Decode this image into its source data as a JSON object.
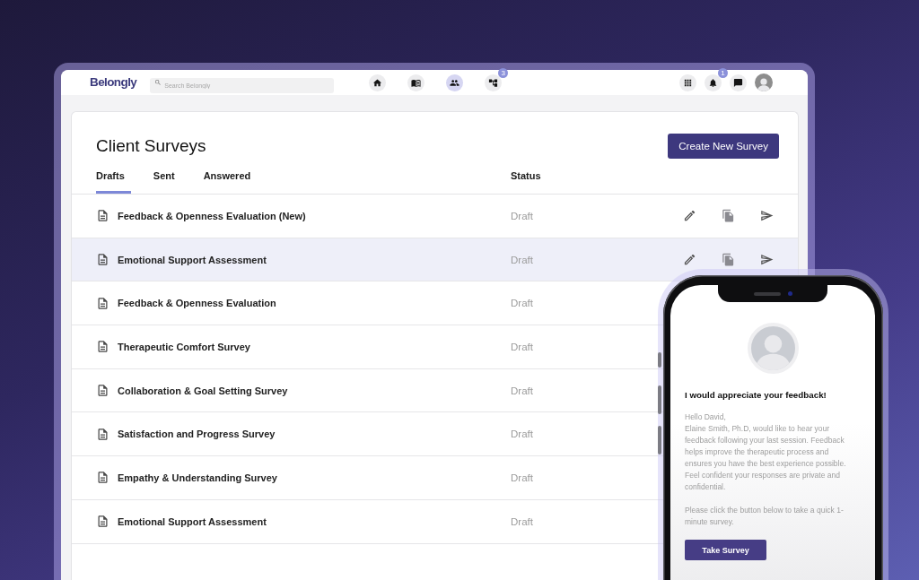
{
  "topbar": {
    "logo": "Belongly",
    "search": {
      "placeholder": "Search Belongly"
    },
    "nav": [
      {
        "kind": "home",
        "selected": false
      },
      {
        "kind": "library",
        "selected": false
      },
      {
        "kind": "people",
        "selected": true
      },
      {
        "kind": "network",
        "selected": false,
        "badge": "3"
      }
    ],
    "actions": [
      {
        "kind": "apps"
      },
      {
        "kind": "notifications",
        "badge": "1"
      },
      {
        "kind": "messages"
      },
      {
        "kind": "avatar"
      }
    ]
  },
  "page": {
    "title": "Client Surveys",
    "create_button": "Create New Survey",
    "tabs": [
      {
        "label": "Drafts",
        "selected": true
      },
      {
        "label": "Sent",
        "selected": false
      },
      {
        "label": "Answered",
        "selected": false
      }
    ]
  },
  "table": {
    "columns": [
      {
        "label": "Status"
      }
    ],
    "rows": [
      {
        "title": "Feedback & Openness Evaluation (New)",
        "status": "Draft",
        "selected": false,
        "actions_visible": true
      },
      {
        "title": "Emotional Support Assessment",
        "status": "Draft",
        "selected": true,
        "actions_visible": true
      },
      {
        "title": "Feedback & Openness Evaluation",
        "status": "Draft",
        "selected": false,
        "actions_visible": false
      },
      {
        "title": "Therapeutic Comfort Survey",
        "status": "Draft",
        "selected": false,
        "actions_visible": false
      },
      {
        "title": "Collaboration & Goal Setting Survey",
        "status": "Draft",
        "selected": false,
        "actions_visible": false
      },
      {
        "title": "Satisfaction and Progress Survey",
        "status": "Draft",
        "selected": false,
        "actions_visible": false
      },
      {
        "title": "Empathy & Understanding Survey",
        "status": "Draft",
        "selected": false,
        "actions_visible": false
      },
      {
        "title": "Emotional Support Assessment",
        "status": "Draft",
        "selected": false,
        "actions_visible": false
      }
    ]
  },
  "phone": {
    "heading": "I would appreciate your feedback!",
    "greeting": "Hello David,",
    "body": "Elaine Smith, Ph.D, would like to hear your feedback following your last session. Feedback helps improve the therapeutic process and ensures you have the best experience possible. Feel confident your responses are private and confidential.",
    "prompt": "Please click the button below to take a quick 1-minute survey.",
    "button": "Take Survey"
  }
}
